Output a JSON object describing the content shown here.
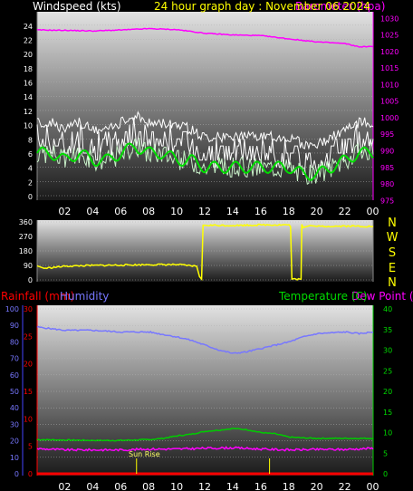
{
  "header": {
    "windspeed_label": "Windspeed (kts)",
    "title": "24 hour graph day : November 06 2024",
    "barometer_label": "Barometer (hpa)"
  },
  "wind_letters": [
    "N",
    "W",
    "S",
    "E",
    "N"
  ],
  "bottom_labels": {
    "rainfall": "Rainfall (mm)",
    "humidity": "Humidity",
    "temperature": "Temperature (C)",
    "dewpoint": "Dew Point (C)",
    "sunrise": "Sun Rise"
  },
  "colors": {
    "windspeed_label": "#ffffff",
    "title": "#ffff00",
    "barometer": "#ff00ff",
    "gust": "#ffffff",
    "average": "#00dd00",
    "direction": "#ffff00",
    "rainfall": "#ff0000",
    "humidity": "#7777ff",
    "temperature": "#00cc00",
    "dewpoint": "#ff00ff",
    "sun_marker": "#ffff00"
  },
  "chart_data": [
    {
      "type": "line",
      "name": "wind-and-barometer",
      "x_ticks": [
        "02",
        "04",
        "06",
        "08",
        "10",
        "12",
        "14",
        "16",
        "18",
        "20",
        "22",
        "00"
      ],
      "y_left_label": "Windspeed (kts)",
      "y_left_ticks": [
        0,
        2,
        4,
        6,
        8,
        10,
        12,
        14,
        16,
        18,
        20,
        22,
        24
      ],
      "y_left_range": [
        0,
        25
      ],
      "y_right_label": "Barometer (hpa)",
      "y_right_ticks": [
        975,
        980,
        985,
        990,
        995,
        1000,
        1005,
        1010,
        1015,
        1020,
        1025,
        1030
      ],
      "y_right_range": [
        974,
        1032
      ],
      "x_range": [
        0,
        24
      ],
      "series": [
        {
          "name": "gust",
          "x": [
            0,
            1,
            2,
            3,
            4,
            5,
            6,
            7,
            8,
            9,
            10,
            11,
            12,
            13,
            14,
            15,
            16,
            17,
            18,
            19,
            20,
            21,
            22,
            23,
            24
          ],
          "values": [
            8,
            8,
            7,
            8,
            7,
            7,
            8,
            9,
            8,
            8,
            8,
            7,
            6,
            6,
            6,
            6,
            6,
            6,
            6,
            5,
            5,
            6,
            7,
            8,
            8
          ]
        },
        {
          "name": "average",
          "x": [
            0,
            1,
            2,
            3,
            4,
            5,
            6,
            7,
            8,
            9,
            10,
            11,
            12,
            13,
            14,
            15,
            16,
            17,
            18,
            19,
            20,
            21,
            22,
            23,
            24
          ],
          "values": [
            6,
            6,
            5,
            6,
            5,
            5,
            6,
            7,
            6,
            6,
            5,
            5,
            4,
            4,
            4,
            4,
            4,
            4,
            4,
            3,
            3,
            4,
            5,
            6,
            6
          ]
        },
        {
          "name": "barometer",
          "x": [
            0,
            2,
            4,
            6,
            8,
            10,
            12,
            14,
            16,
            18,
            20,
            22,
            23,
            24
          ],
          "values": [
            1026.5,
            1026.4,
            1026.2,
            1026.5,
            1026.9,
            1026.6,
            1025.5,
            1025.0,
            1024.8,
            1023.8,
            1022.9,
            1022.4,
            1021.4,
            1021.5
          ]
        }
      ]
    },
    {
      "type": "line",
      "name": "wind-direction",
      "x_ticks": [
        "02",
        "04",
        "06",
        "08",
        "10",
        "12",
        "14",
        "16",
        "18",
        "20",
        "22",
        "00"
      ],
      "y_ticks": [
        0,
        90,
        180,
        270,
        360
      ],
      "y_range": [
        0,
        360
      ],
      "x_range": [
        0,
        24
      ],
      "series": [
        {
          "name": "direction",
          "x": [
            0,
            0.5,
            2,
            4,
            6,
            8,
            10,
            11.4,
            11.6,
            11.75,
            11.85,
            12,
            14,
            16,
            18,
            18.1,
            18.2,
            18.85,
            18.9,
            19,
            19.5,
            20,
            22,
            24
          ],
          "values": [
            88,
            72,
            85,
            90,
            92,
            95,
            95,
            85,
            20,
            5,
            340,
            340,
            338,
            342,
            342,
            330,
            5,
            5,
            345,
            325,
            338,
            332,
            335,
            332
          ]
        }
      ]
    },
    {
      "type": "line",
      "name": "rain-humidity-temperature",
      "x_ticks": [
        "02",
        "04",
        "06",
        "08",
        "10",
        "12",
        "14",
        "16",
        "18",
        "20",
        "22",
        "00"
      ],
      "y_rain_ticks": [
        0,
        5,
        10,
        15,
        20,
        25,
        30
      ],
      "y_rain_range": [
        0,
        30
      ],
      "y_humidity_ticks": [
        0,
        10,
        20,
        30,
        40,
        50,
        60,
        70,
        80,
        90,
        100
      ],
      "y_humidity_range": [
        0,
        100
      ],
      "y_temp_ticks": [
        0,
        5,
        10,
        15,
        20,
        25,
        30,
        35,
        40
      ],
      "y_temp_range": [
        0,
        40
      ],
      "x_range": [
        0,
        24
      ],
      "series": [
        {
          "name": "humidity",
          "x": [
            0,
            1,
            2,
            4,
            6,
            8,
            10,
            11,
            12,
            13,
            14,
            15,
            16,
            17,
            18,
            19,
            20,
            22,
            23,
            24
          ],
          "values": [
            89,
            88,
            87,
            87,
            86,
            86,
            83,
            81,
            78,
            75,
            73,
            74,
            76,
            78,
            80,
            83,
            85,
            86,
            85,
            86
          ]
        },
        {
          "name": "temperature",
          "x": [
            0,
            2,
            4,
            6,
            8,
            9,
            10,
            11,
            12,
            13,
            14,
            15,
            16,
            17,
            18,
            19,
            20,
            22,
            24
          ],
          "values": [
            8.3,
            8.2,
            8.1,
            8.1,
            8.3,
            8.6,
            9.2,
            9.6,
            10.3,
            10.6,
            11.0,
            10.7,
            10.0,
            9.7,
            8.9,
            8.7,
            8.6,
            8.6,
            8.6
          ]
        },
        {
          "name": "dewpoint",
          "x": [
            0,
            2,
            4,
            6,
            8,
            10,
            12,
            14,
            16,
            18,
            20,
            22,
            24
          ],
          "values": [
            6.1,
            5.8,
            5.8,
            5.8,
            6.0,
            6.0,
            6.2,
            6.3,
            6.0,
            5.8,
            5.9,
            5.9,
            6.2
          ]
        },
        {
          "name": "rainfall",
          "x": [
            0,
            24
          ],
          "values": [
            0,
            0
          ]
        }
      ],
      "sun_markers": [
        7.1,
        16.6
      ]
    }
  ]
}
